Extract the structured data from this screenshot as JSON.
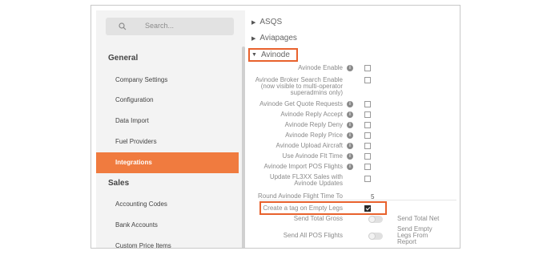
{
  "sidebar": {
    "search_placeholder": "Search...",
    "sections": [
      {
        "title": "General",
        "items": [
          "Company Settings",
          "Configuration",
          "Data Import",
          "Fuel Providers",
          "Integrations"
        ]
      },
      {
        "title": "Sales",
        "items": [
          "Accounting Codes",
          "Bank Accounts",
          "Custom Price Items"
        ]
      }
    ],
    "active_item": "Integrations"
  },
  "content": {
    "accordions": [
      {
        "label": "ASQS",
        "expanded": false
      },
      {
        "label": "Aviapages",
        "expanded": false
      },
      {
        "label": "Avinode",
        "expanded": true
      }
    ],
    "avinode_settings": [
      {
        "label": "Avinode Enable",
        "info": true,
        "checked": false
      },
      {
        "label": "Avinode Broker Search Enable (now visible to multi-operator superadmins only)",
        "info": false,
        "checked": false
      },
      {
        "label": "Avinode Get Quote Requests",
        "info": true,
        "checked": false
      },
      {
        "label": "Avinode Reply Accept",
        "info": true,
        "checked": false
      },
      {
        "label": "Avinode Reply Deny",
        "info": true,
        "checked": false
      },
      {
        "label": "Avinode Reply Price",
        "info": true,
        "checked": false
      },
      {
        "label": "Avinode Upload Aircraft",
        "info": true,
        "checked": false
      },
      {
        "label": "Use Avinode Flt Time",
        "info": true,
        "checked": false
      },
      {
        "label": "Avinode Import POS Flights",
        "info": true,
        "checked": false
      },
      {
        "label": "Update FL3XX Sales with Avinode Updates",
        "info": false,
        "checked": false
      }
    ],
    "round_time": {
      "label": "Round Avinode Flight Time To",
      "value": "5"
    },
    "empty_legs_tag": {
      "label": "Create a tag on Empty Legs",
      "checked": true
    },
    "toggles": [
      {
        "label": "Send Total Gross",
        "side_label": "Send Total Net"
      },
      {
        "label": "Send All POS Flights",
        "side_label": "Send Empty Legs From Report"
      }
    ]
  },
  "colors": {
    "accent": "#f07b3f",
    "highlight_border": "#e8622d"
  }
}
